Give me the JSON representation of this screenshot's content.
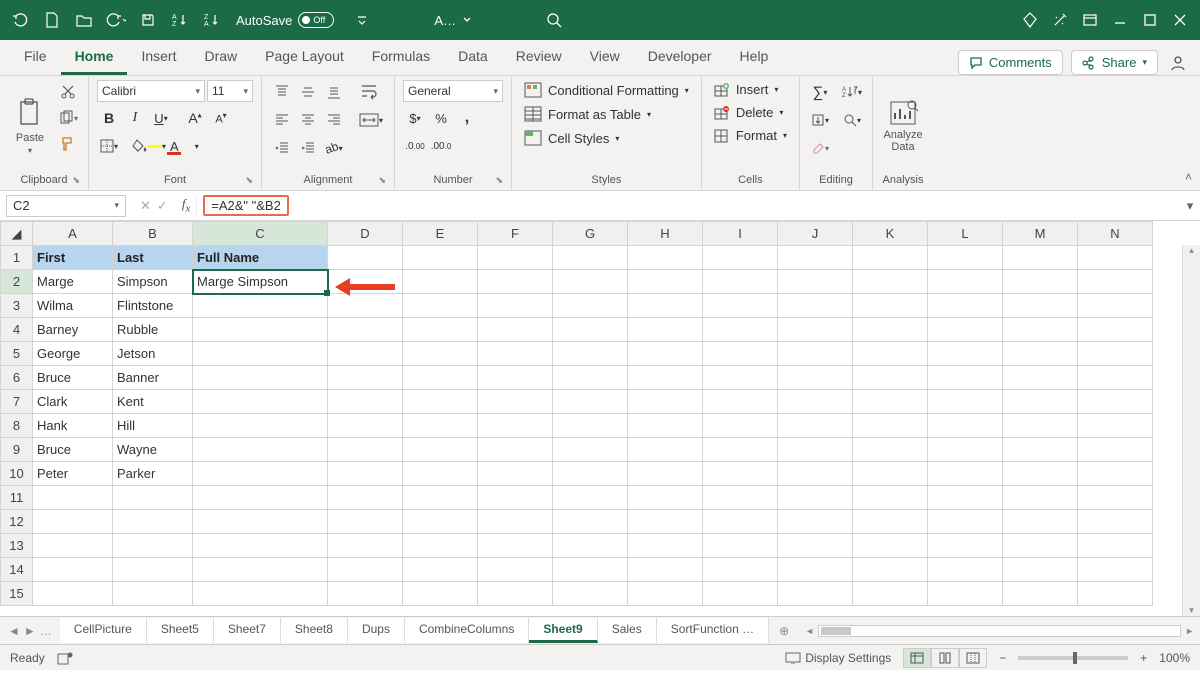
{
  "titlebar": {
    "autosave_label": "AutoSave",
    "autosave_state": "Off",
    "doc_short": "A…"
  },
  "tabs": {
    "items": [
      "File",
      "Home",
      "Insert",
      "Draw",
      "Page Layout",
      "Formulas",
      "Data",
      "Review",
      "View",
      "Developer",
      "Help"
    ],
    "active": "Home",
    "comments": "Comments",
    "share": "Share"
  },
  "ribbon": {
    "clipboard": {
      "paste": "Paste",
      "label": "Clipboard"
    },
    "font": {
      "name": "Calibri",
      "size": "11",
      "label": "Font"
    },
    "alignment": {
      "label": "Alignment"
    },
    "number": {
      "format": "General",
      "label": "Number"
    },
    "styles": {
      "cond": "Conditional Formatting",
      "table": "Format as Table",
      "cell": "Cell Styles",
      "label": "Styles"
    },
    "cells": {
      "insert": "Insert",
      "delete": "Delete",
      "format": "Format",
      "label": "Cells"
    },
    "editing": {
      "label": "Editing"
    },
    "analysis": {
      "analyze": "Analyze Data",
      "label": "Analysis"
    }
  },
  "formulabar": {
    "namebox": "C2",
    "formula": "=A2&\" \"&B2"
  },
  "grid": {
    "columns": [
      "A",
      "B",
      "C",
      "D",
      "E",
      "F",
      "G",
      "H",
      "I",
      "J",
      "K",
      "L",
      "M",
      "N"
    ],
    "headers": {
      "A": "First",
      "B": "Last",
      "C": "Full Name"
    },
    "rows": [
      {
        "A": "Marge",
        "B": "Simpson",
        "C": "Marge Simpson"
      },
      {
        "A": "Wilma",
        "B": "Flintstone",
        "C": ""
      },
      {
        "A": "Barney",
        "B": "Rubble",
        "C": ""
      },
      {
        "A": "George",
        "B": "Jetson",
        "C": ""
      },
      {
        "A": "Bruce",
        "B": "Banner",
        "C": ""
      },
      {
        "A": "Clark",
        "B": "Kent",
        "C": ""
      },
      {
        "A": "Hank",
        "B": "Hill",
        "C": ""
      },
      {
        "A": "Bruce",
        "B": "Wayne",
        "C": ""
      },
      {
        "A": "Peter",
        "B": "Parker",
        "C": ""
      }
    ],
    "selected": "C2",
    "total_rows": 15
  },
  "sheets": {
    "tabs": [
      "CellPicture",
      "Sheet5",
      "Sheet7",
      "Sheet8",
      "Dups",
      "CombineColumns",
      "Sheet9",
      "Sales",
      "SortFunction …"
    ],
    "active": "Sheet9"
  },
  "status": {
    "ready": "Ready",
    "display_settings": "Display Settings",
    "zoom": "100%"
  }
}
